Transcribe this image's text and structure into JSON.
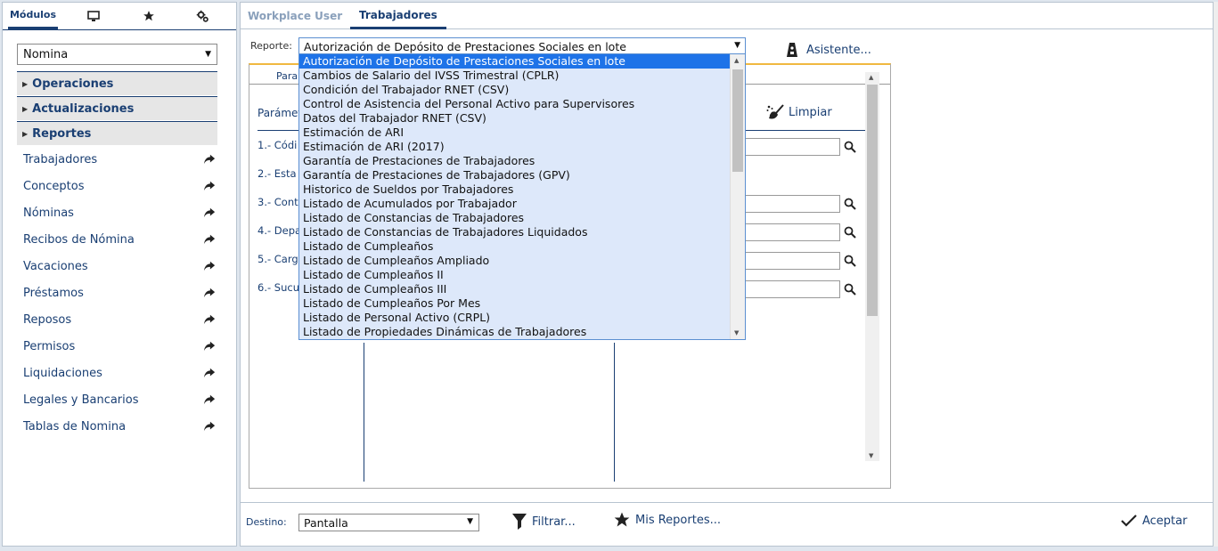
{
  "left_panel": {
    "tabs": {
      "modulos": "Módulos"
    },
    "module_select": "Nomina",
    "sections": [
      "Operaciones",
      "Actualizaciones",
      "Reportes"
    ],
    "menu_items": [
      "Trabajadores",
      "Conceptos",
      "Nóminas",
      "Recibos de Nómina",
      "Vacaciones",
      "Préstamos",
      "Reposos",
      "Permisos",
      "Liquidaciones",
      "Legales y Bancarios",
      "Tablas de Nomina"
    ]
  },
  "right_panel": {
    "tabs": {
      "workplace": "Workplace User",
      "trabajadores": "Trabajadores"
    },
    "reporte_label": "Reporte:",
    "reporte_selected": "Autorización de Depósito de Prestaciones Sociales en lote",
    "asistente": "Asistente...",
    "inner_tab": "Para",
    "params_header": "Parámet",
    "limpiar": "Limpiar",
    "params": [
      "1.- Códi",
      "2.- Esta",
      "3.- Cont",
      "4.- Depa",
      "5.- Carg",
      "6.- Sucu"
    ],
    "destino_label": "Destino:",
    "destino_value": "Pantalla",
    "filtrar": "Filtrar...",
    "mis_reportes": "Mis Reportes...",
    "aceptar": "Aceptar"
  },
  "dropdown": {
    "items": [
      "Autorización de Depósito de Prestaciones Sociales en lote",
      "Cambios de Salario del IVSS Trimestral (CPLR)",
      "Condición del Trabajador RNET (CSV)",
      "Control de Asistencia del Personal Activo para Supervisores",
      "Datos del Trabajador RNET (CSV)",
      "Estimación de ARI",
      "Estimación de ARI (2017)",
      "Garantía de Prestaciones de Trabajadores",
      "Garantía de Prestaciones de Trabajadores (GPV)",
      "Historico de Sueldos por Trabajadores",
      "Listado de Acumulados por Trabajador",
      "Listado de Constancias de Trabajadores",
      "Listado de Constancias de Trabajadores Liquidados",
      "Listado de Cumpleaños",
      "Listado de Cumpleaños Ampliado",
      "Listado de Cumpleaños II",
      "Listado de Cumpleaños III",
      "Listado de Cumpleaños Por Mes",
      "Listado de Personal Activo (CRPL)",
      "Listado de Propiedades Dinámicas de Trabajadores"
    ]
  }
}
